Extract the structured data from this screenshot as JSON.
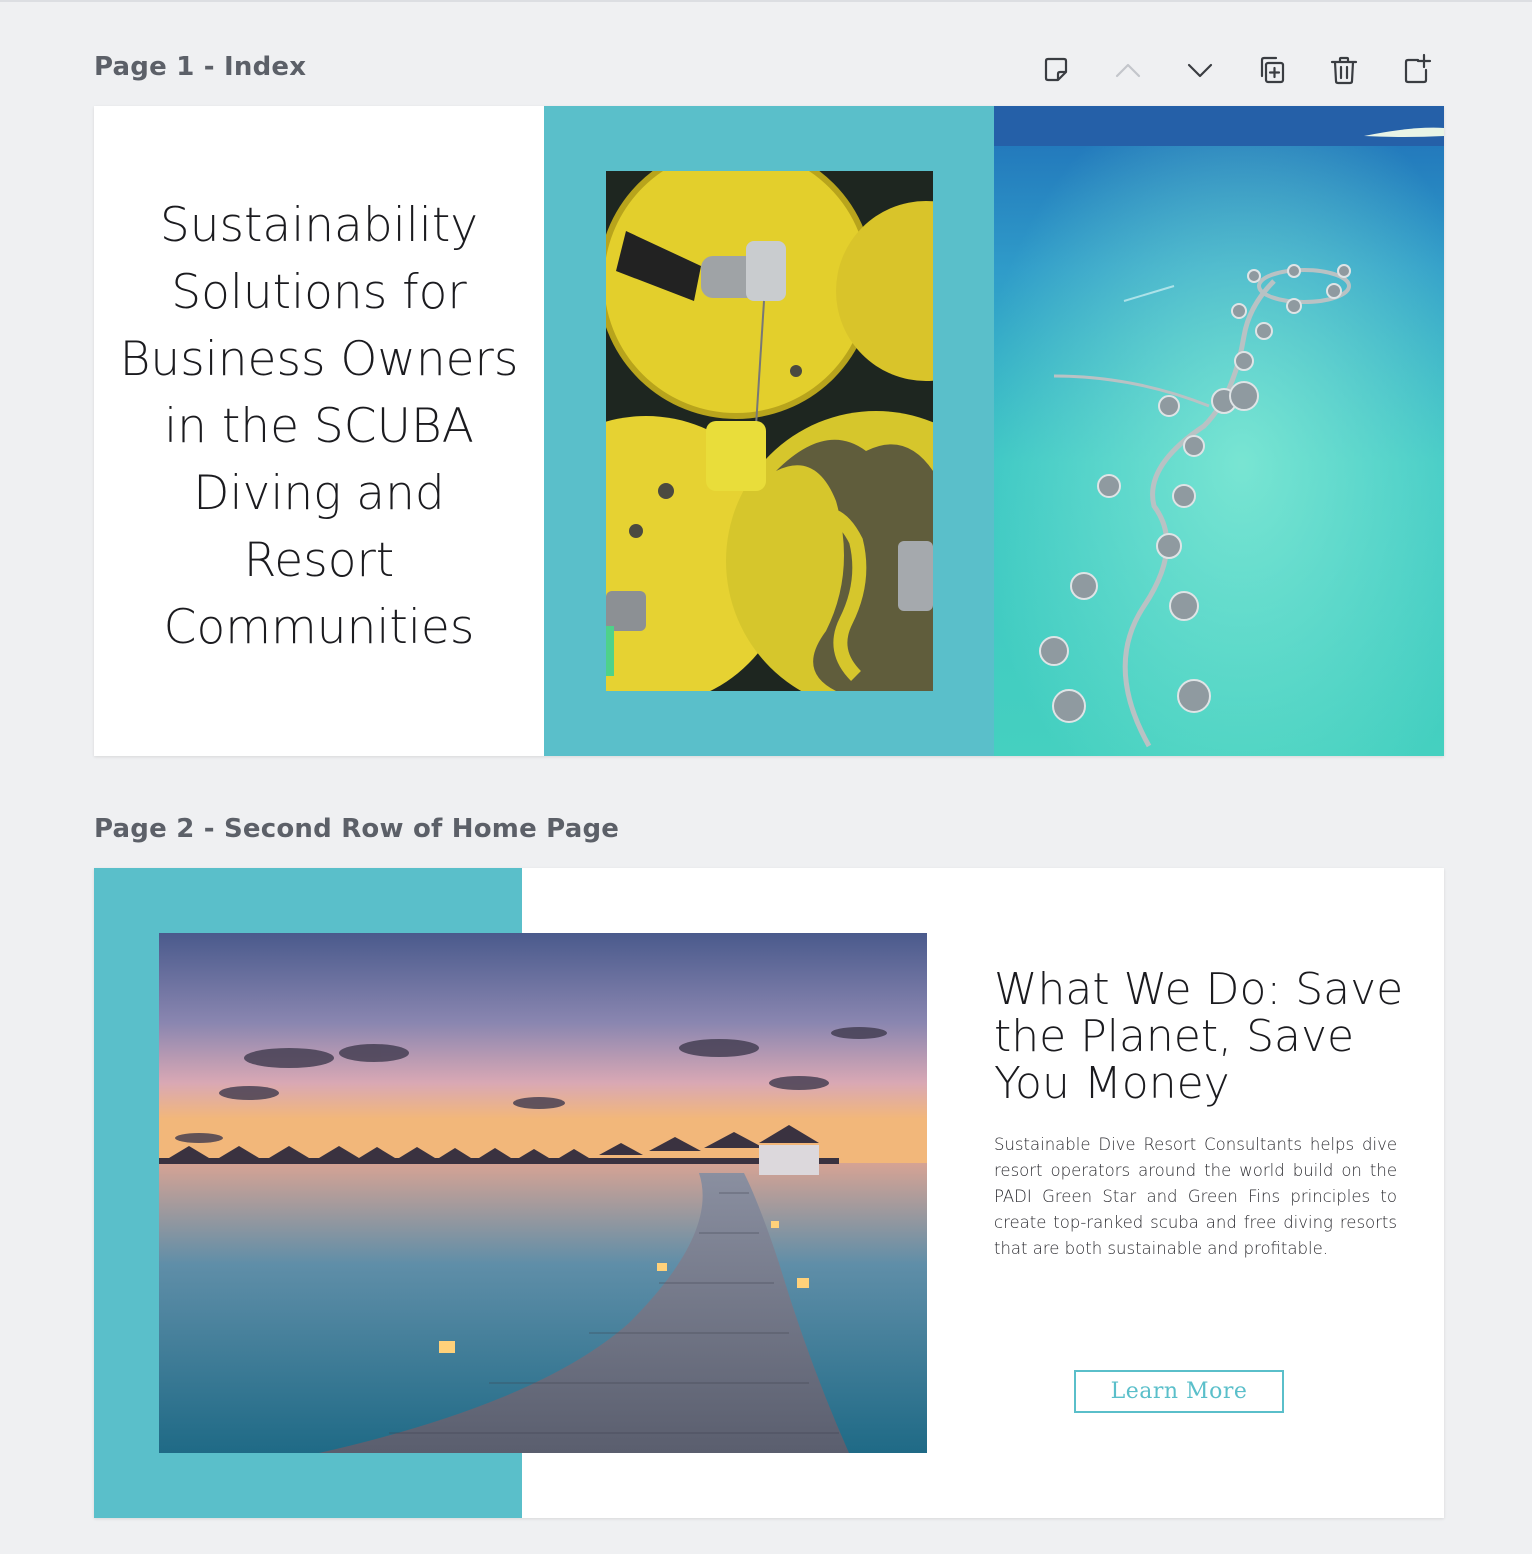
{
  "colors": {
    "canvas_bg": "#eff0f2",
    "label": "#5c6068",
    "teal": "#5abfca",
    "icon": "#3a3d42",
    "icon_disabled": "#c3c6cb"
  },
  "toolbar": {
    "icons": [
      "sticky-note-icon",
      "chevron-up-icon",
      "chevron-down-icon",
      "duplicate-icon",
      "trash-icon",
      "add-page-icon"
    ],
    "move_up_disabled": true
  },
  "page1": {
    "label": "Page 1 - Index",
    "title_lines": [
      "Sustainability",
      "Solutions for",
      "Business Owners",
      "in the SCUBA",
      "Diving and Resort",
      "Communities"
    ]
  },
  "page2": {
    "label": "Page 2 - Second Row of Home Page",
    "heading_lines": [
      "What We Do: Save",
      "the Planet, Save",
      "You Money"
    ],
    "body": "Sustainable Dive Resort Consultants helps dive resort operators around the world build on the PADI Green Star and Green Fins principles to create top-ranked scuba and free diving resorts that are both sustainable and profitable.",
    "button_label": "Learn More"
  }
}
